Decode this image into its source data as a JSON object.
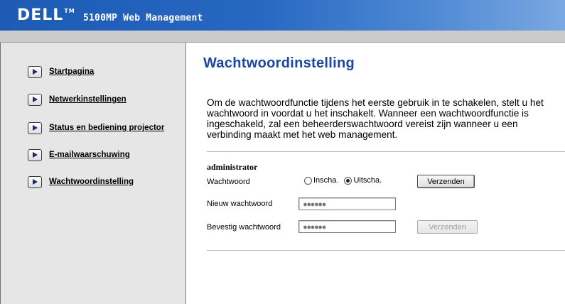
{
  "header": {
    "logo": "DELL",
    "logo_tm": "TM",
    "title": "5100MP Web Management"
  },
  "sidebar": {
    "items": [
      {
        "label": "Startpagina"
      },
      {
        "label": "Netwerkinstellingen"
      },
      {
        "label": "Status en bediening projector"
      },
      {
        "label": "E-mailwaarschuwing"
      },
      {
        "label": "Wachtwoordinstelling"
      }
    ]
  },
  "main": {
    "title": "Wachtwoordinstelling",
    "intro": "Om de wachtwoordfunctie tijdens het eerste gebruik in te schakelen, stelt u het wachtwoord in voordat u het inschakelt. Wanneer een wachtwoordfunctie is ingeschakeld, zal een beheerderswachtwoord vereist zijn wanneer u een verbinding maakt met het web management.",
    "section_title": "administrator",
    "password_label": "Wachtwoord",
    "radio_enable": "Inscha.",
    "radio_disable": "Uitscha.",
    "radio_selected": "Uitscha.",
    "submit_label": "Verzenden",
    "new_password_label": "Nieuw wachtwoord",
    "new_password_value": "●●●●●●",
    "confirm_password_label": "Bevestig wachtwoord",
    "confirm_password_value": "●●●●●●",
    "confirm_submit_label": "Verzenden"
  },
  "colors": {
    "header_blue": "#1d5bb4",
    "title_blue": "#1a48a6",
    "sidebar_bg": "#e6e6e6"
  }
}
